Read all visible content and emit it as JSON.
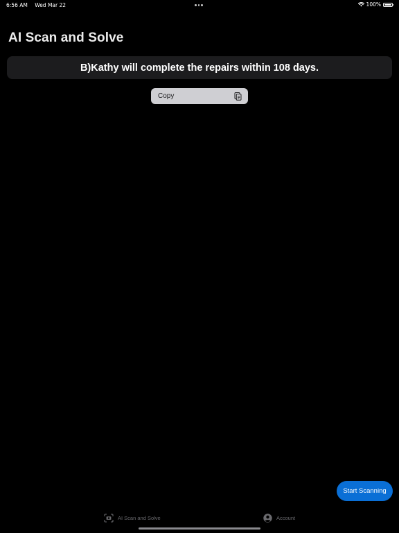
{
  "status_bar": {
    "time": "6:56 AM",
    "date": "Wed Mar 22",
    "battery": "100%",
    "icons": [
      "multitask-dots-icon",
      "wifi-icon",
      "battery-icon"
    ]
  },
  "header": {
    "title": "AI Scan and Solve"
  },
  "result": {
    "text": "B)Kathy will complete the repairs within 108 days."
  },
  "context_menu": {
    "copy_label": "Copy",
    "icon": "copy-icon"
  },
  "actions": {
    "start_scanning": "Start Scanning"
  },
  "tab_bar": {
    "tabs": [
      {
        "label": "AI Scan and Solve",
        "icon": "scan-icon"
      },
      {
        "label": "Account",
        "icon": "account-icon"
      }
    ]
  },
  "colors": {
    "background": "#000000",
    "card": "#1c1c1e",
    "menu": "#cfcfd3",
    "accent": "#0a6fd6",
    "tab_inactive": "#6a6a6e"
  }
}
